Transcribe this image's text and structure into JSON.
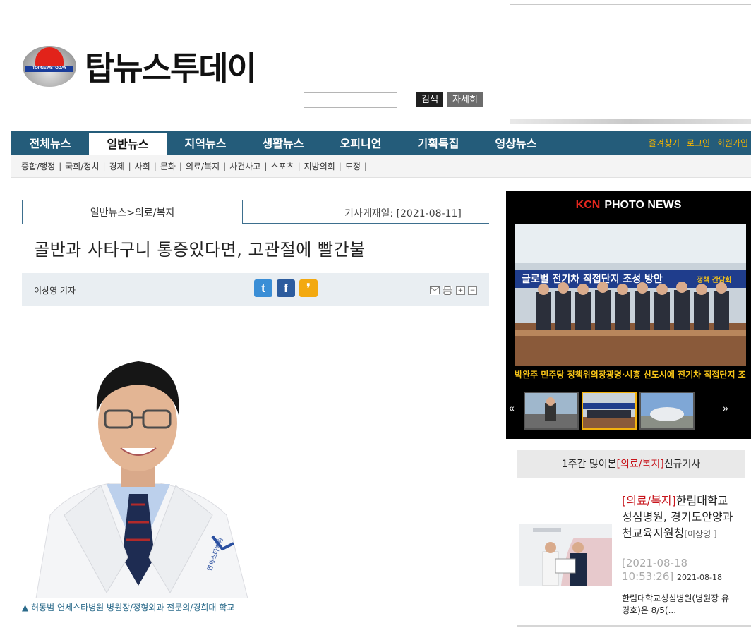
{
  "header": {
    "logo_text": "탑뉴스투데이",
    "logo_band": "TOPNEWSTODAY",
    "search_button": "검색",
    "detail_button": "자세히"
  },
  "nav": {
    "items": [
      {
        "label": "전체뉴스",
        "active": false
      },
      {
        "label": "일반뉴스",
        "active": true
      },
      {
        "label": "지역뉴스",
        "active": false
      },
      {
        "label": "생활뉴스",
        "active": false
      },
      {
        "label": "오피니언",
        "active": false
      },
      {
        "label": "기획특집",
        "active": false
      },
      {
        "label": "영상뉴스",
        "active": false
      }
    ],
    "util": [
      "즐겨찾기",
      "로그인",
      "회원가입"
    ],
    "sub_items": [
      "종합/행정",
      "국회/정치",
      "경제",
      "사회",
      "문화",
      "의료/복지",
      "사건사고",
      "스포츠",
      "지방의회",
      "도정"
    ]
  },
  "article": {
    "breadcrumb": "일반뉴스>의료/복지",
    "date_line": "기사게재일: [2021-08-11]",
    "headline": "골반과 사타구니 통증있다면, 고관절에 빨간불",
    "reporter": "이상영 기자",
    "caption": "▲ 허동범 연세스타병원 병원장/정형외과 전문의/경희대 학교",
    "photo_badge": "연세스타병원"
  },
  "photo_news": {
    "brand": "KCN",
    "title": "PHOTO NEWS",
    "banner": "글로벌 전기차 직접단지 조성 방안",
    "banner_tag": "정책 간담회",
    "caption": "박완주 민주당 정책위의장광명·시흥 신도시에 전기차 직접단지 조성 건의"
  },
  "ranking": {
    "head_prefix": "1주간 많이본",
    "head_cat": "[의료/복지]",
    "head_suffix": "신규기사",
    "item": {
      "cat": "[의료/복지]",
      "title": "한림대학교성심병원, 경기도안양과천교육지원청",
      "byline": "[이상영 ]",
      "stamp": "[2021-08-18 10:53:26]",
      "date": "2021-08-18",
      "summary": "한림대학교성심병원(병원장 유경호)은 8/5(..."
    }
  }
}
